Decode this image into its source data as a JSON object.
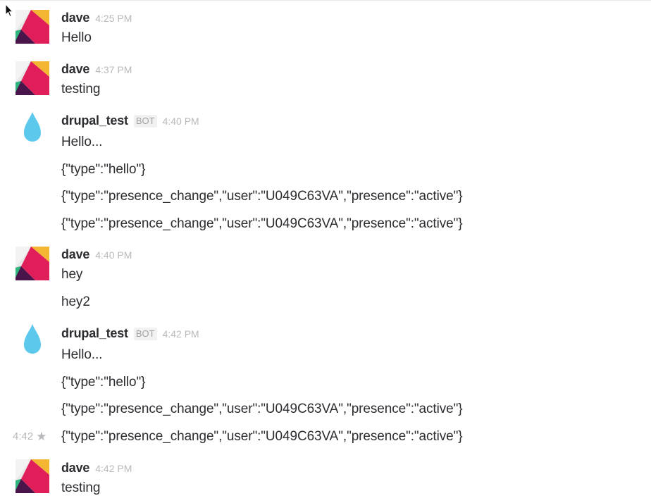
{
  "colors": {
    "sender_text": "#2c2d30",
    "timestamp_text": "#b9b9bc",
    "bot_badge_bg": "#f1f1f1",
    "drop_icon": "#5bc8ec"
  },
  "messages": [
    {
      "sender": "dave",
      "avatar": "dave-avatar-icon",
      "time": "4:25 PM",
      "lines": [
        "Hello"
      ]
    },
    {
      "sender": "dave",
      "avatar": "dave-avatar-icon",
      "time": "4:37 PM",
      "lines": [
        "testing"
      ]
    },
    {
      "sender": "drupal_test",
      "avatar": "drupal-drop-icon",
      "badge": "BOT",
      "time": "4:40 PM",
      "lines": [
        "Hello...",
        "{\"type\":\"hello\"}",
        "{\"type\":\"presence_change\",\"user\":\"U049C63VA\",\"presence\":\"active\"}",
        "{\"type\":\"presence_change\",\"user\":\"U049C63VA\",\"presence\":\"active\"}"
      ]
    },
    {
      "sender": "dave",
      "avatar": "dave-avatar-icon",
      "time": "4:40 PM",
      "lines": [
        "hey",
        "hey2"
      ]
    },
    {
      "sender": "drupal_test",
      "avatar": "drupal-drop-icon",
      "badge": "BOT",
      "time": "4:42 PM",
      "lines": [
        "Hello...",
        "{\"type\":\"hello\"}",
        "{\"type\":\"presence_change\",\"user\":\"U049C63VA\",\"presence\":\"active\"}",
        "{\"type\":\"presence_change\",\"user\":\"U049C63VA\",\"presence\":\"active\"}"
      ],
      "hover_line": {
        "time": "4:42",
        "icon": "star-icon"
      }
    },
    {
      "sender": "dave",
      "avatar": "dave-avatar-icon",
      "time": "4:42 PM",
      "lines": [
        "testing"
      ]
    }
  ]
}
